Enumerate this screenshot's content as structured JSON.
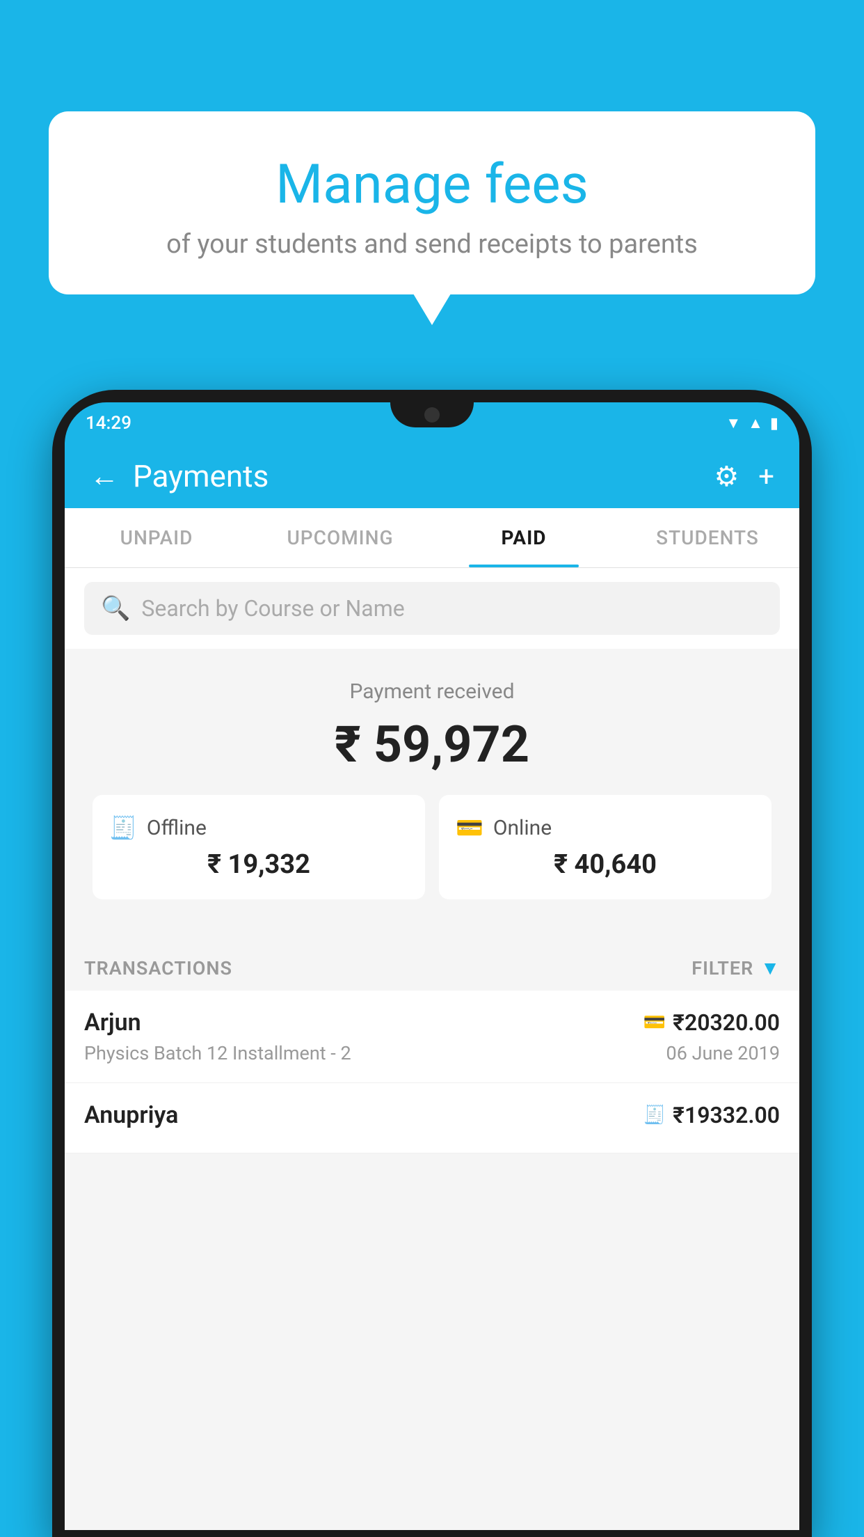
{
  "background_color": "#1ab5e8",
  "bubble": {
    "title": "Manage fees",
    "subtitle": "of your students and send receipts to parents"
  },
  "status_bar": {
    "time": "14:29",
    "icons": [
      "wifi",
      "signal",
      "battery"
    ]
  },
  "header": {
    "back_label": "←",
    "title": "Payments",
    "settings_icon": "⚙",
    "add_icon": "+"
  },
  "tabs": [
    {
      "label": "UNPAID",
      "active": false
    },
    {
      "label": "UPCOMING",
      "active": false
    },
    {
      "label": "PAID",
      "active": true
    },
    {
      "label": "STUDENTS",
      "active": false
    }
  ],
  "search": {
    "placeholder": "Search by Course or Name"
  },
  "payment_summary": {
    "label": "Payment received",
    "total": "₹ 59,972",
    "offline_label": "Offline",
    "offline_amount": "₹ 19,332",
    "online_label": "Online",
    "online_amount": "₹ 40,640"
  },
  "transactions": {
    "header_label": "TRANSACTIONS",
    "filter_label": "FILTER",
    "items": [
      {
        "name": "Arjun",
        "detail": "Physics Batch 12 Installment - 2",
        "amount": "₹20320.00",
        "date": "06 June 2019",
        "type": "online"
      },
      {
        "name": "Anupriya",
        "detail": "",
        "amount": "₹19332.00",
        "date": "",
        "type": "offline"
      }
    ]
  }
}
